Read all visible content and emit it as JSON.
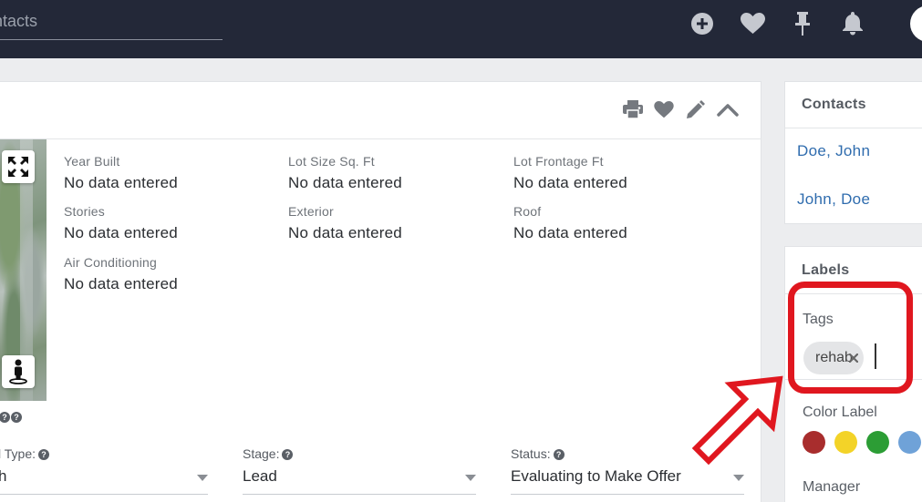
{
  "header": {
    "search_placeholder": "Contacts",
    "icons": [
      "plus-circle-icon",
      "heart-icon",
      "pin-icon",
      "bell-icon"
    ]
  },
  "card": {
    "tool_icons": [
      "print-icon",
      "heart-icon",
      "pencil-icon",
      "chevron-up-icon"
    ],
    "fields": [
      {
        "label": "Year Built",
        "value": "No data entered"
      },
      {
        "label": "Lot Size Sq. Ft",
        "value": "No data entered"
      },
      {
        "label": "Lot Frontage Ft",
        "value": "No data entered"
      },
      {
        "label": "Stories",
        "value": "No data entered"
      },
      {
        "label": "Exterior",
        "value": "No data entered"
      },
      {
        "label": "Roof",
        "value": "No data entered"
      },
      {
        "label": "Air Conditioning",
        "value": "No data entered"
      }
    ],
    "selects": [
      {
        "label": "l Type:",
        "value": "h"
      },
      {
        "label": "Stage:",
        "value": "Lead"
      },
      {
        "label": "Status:",
        "value": "Evaluating to Make Offer"
      }
    ]
  },
  "contacts_panel": {
    "title": "Contacts",
    "items": [
      "Doe, John",
      "John, Doe"
    ]
  },
  "labels_panel": {
    "title": "Labels",
    "tags_label": "Tags",
    "tags": [
      "rehab"
    ],
    "color_label": "Color Label",
    "colors": [
      "#a82d2d",
      "#f3d328",
      "#2c9d35",
      "#6fa2d8"
    ],
    "manager_label": "Manager"
  },
  "colors": {
    "topbar": "#232838",
    "link": "#2f6cae",
    "annotation": "#e0171f"
  }
}
